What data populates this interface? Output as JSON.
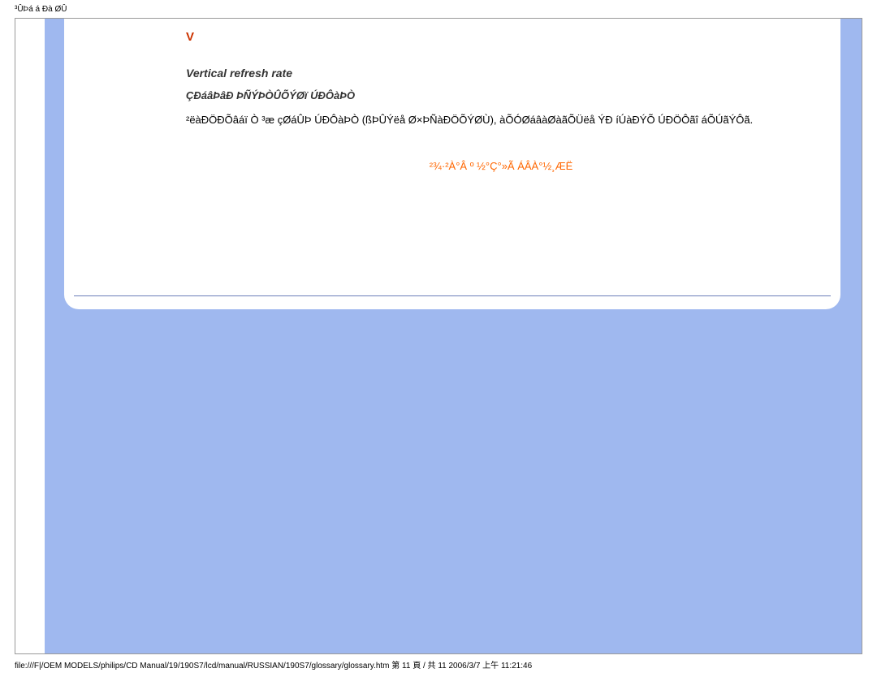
{
  "header": {
    "doc_label": "³ÛÞá á Ðà ØÛ"
  },
  "content": {
    "section_letter": "V",
    "term_title": "Vertical refresh rate",
    "term_subtitle": "ÇÐáâÞâÐ ÞÑÝÞÒÛÕÝØï ÚÐÔàÞÒ",
    "term_body": "²ëàÐÖÐÕâáï Ò ³æ çØáÛÞ ÚÐÔàÞÒ (ßÞÛÝëå Ø×ÞÑàÐÖÕÝØÙ), àÕÓØáâàØàãÕÜëå ÝÐ íÚàÐÝÕ ÚÐÖÔãî áÕÚãÝÔã.",
    "back_link": "²¾·²À°Â º ½°Ç°»Ã ÁÂÀ°½¸ÆË"
  },
  "footer": {
    "path": "file:///F|/OEM MODELS/philips/CD Manual/19/190S7/lcd/manual/RUSSIAN/190S7/glossary/glossary.htm 第 11 頁 / 共 11 2006/3/7 上午 11:21:46"
  }
}
